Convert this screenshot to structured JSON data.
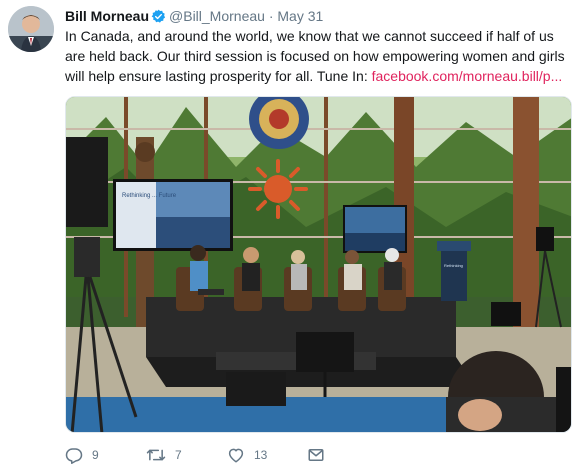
{
  "tweet": {
    "author": {
      "name": "Bill Morneau",
      "handle": "@Bill_Morneau",
      "verified": true,
      "avatar_icon": "person-avatar"
    },
    "separator": "·",
    "date": "May 31",
    "body": "In Canada, and around the world, we know that we cannot succeed if half of us are held back. Our third session is focused on how empowering women and girls will help ensure lasting prosperity for all. Tune In: ",
    "link": "facebook.com/morneau.bill/p...",
    "media": {
      "screen_text": "Rethinking ... Future",
      "podium_text": "Rethinking"
    },
    "actions": {
      "replies": "9",
      "retweets": "7",
      "likes": "13"
    },
    "colors": {
      "link": "#e0245e",
      "verified": "#1da1f2",
      "muted": "#657786"
    }
  }
}
